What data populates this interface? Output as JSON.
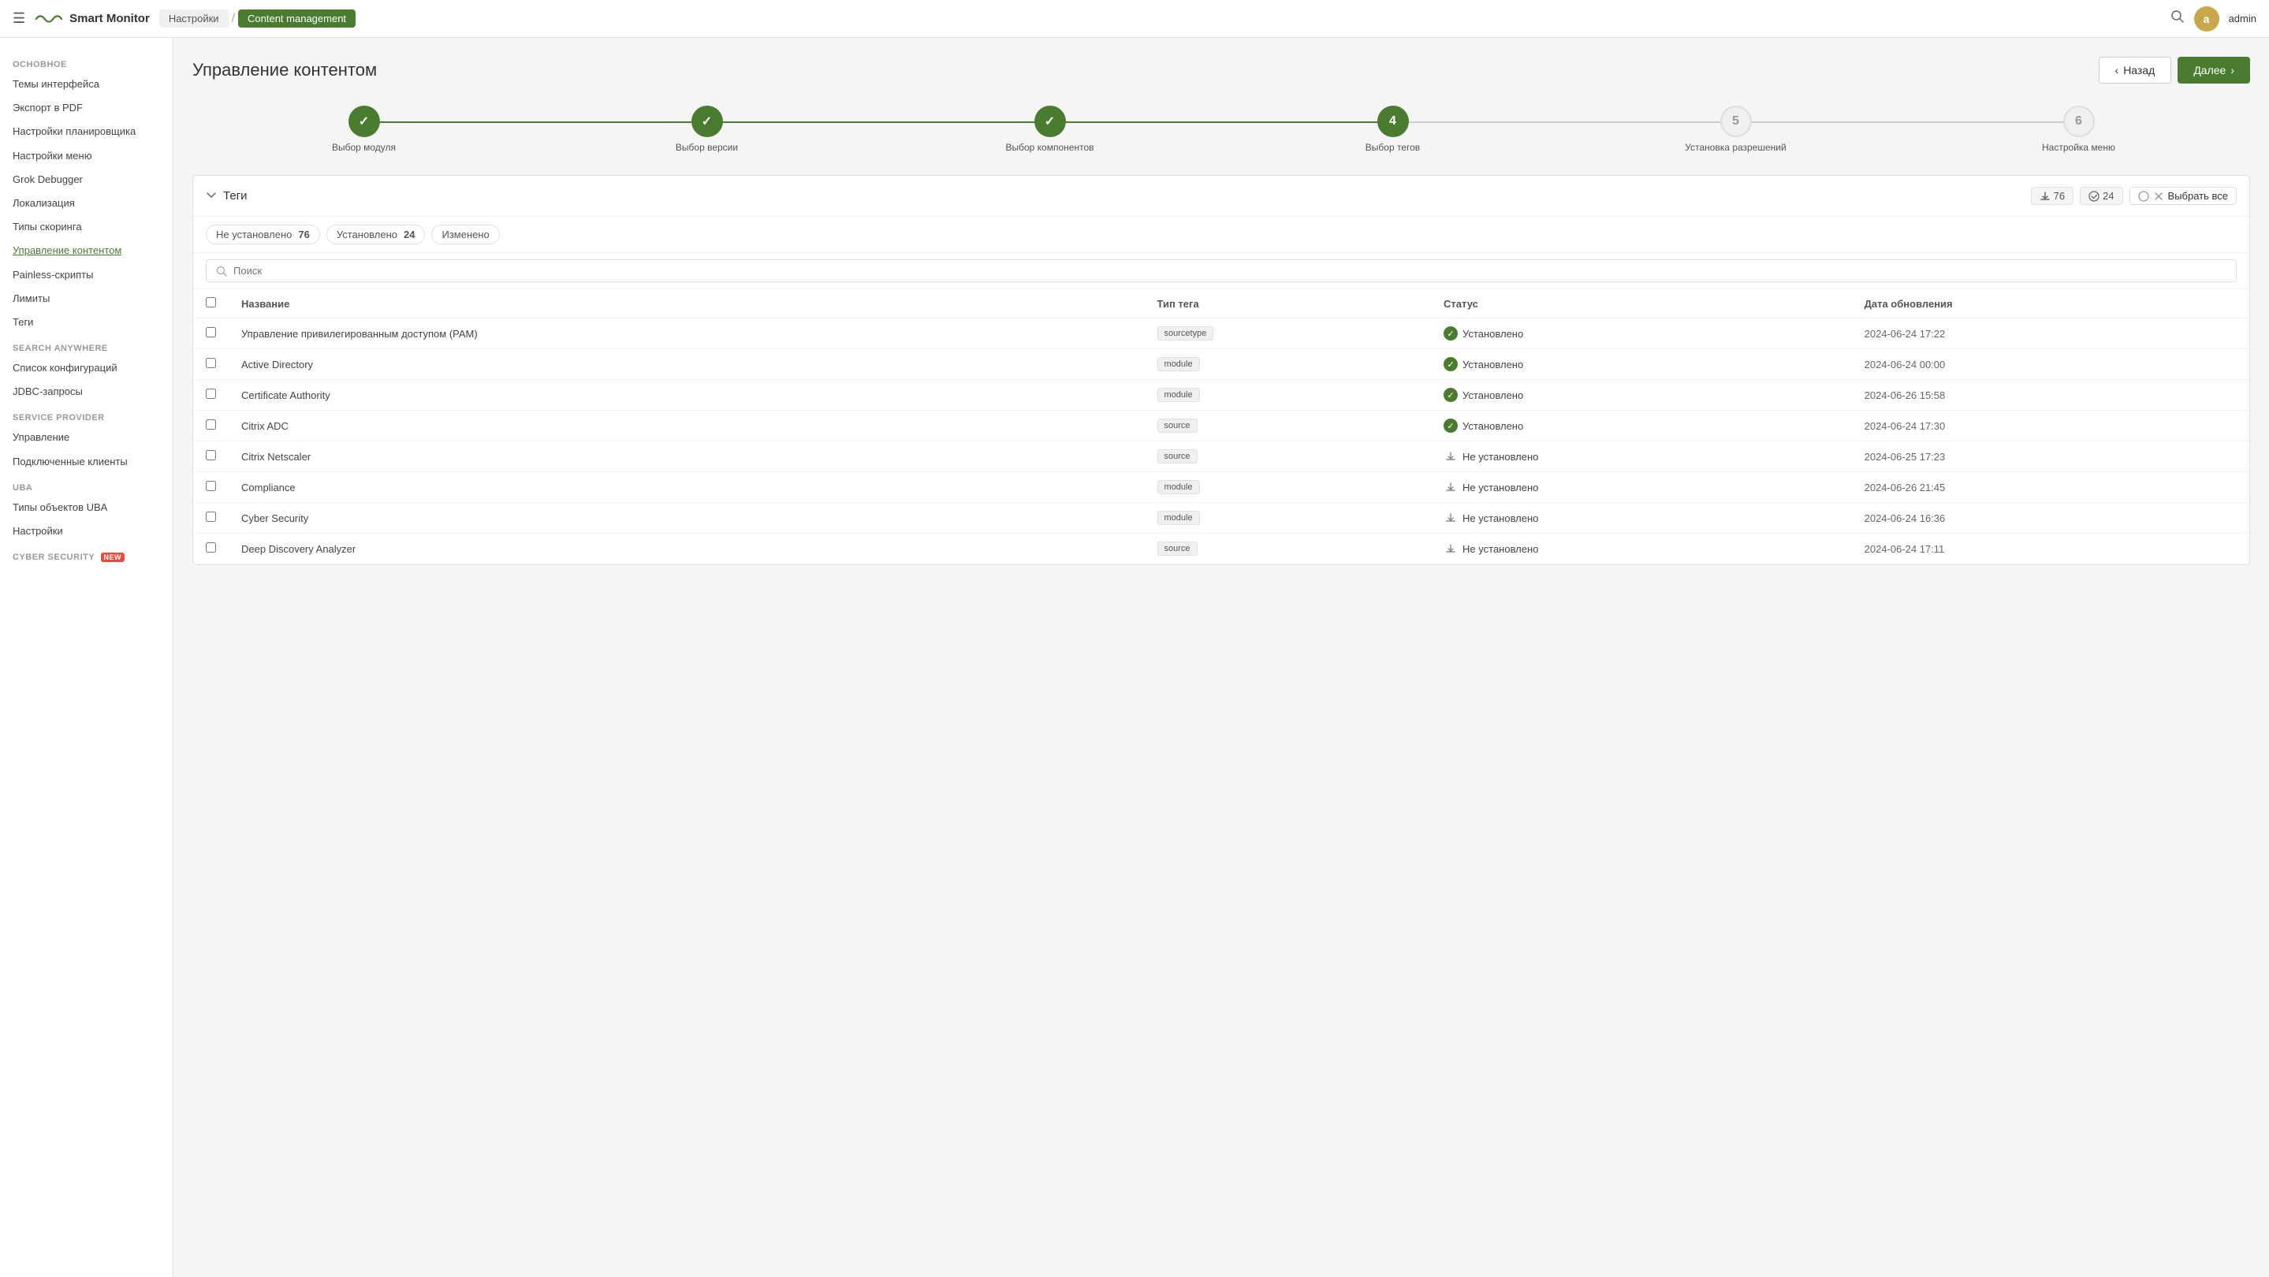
{
  "header": {
    "menu_icon": "☰",
    "logo_text": "Smart Monitor",
    "breadcrumbs": [
      {
        "label": "Настройки",
        "active": false
      },
      {
        "label": "Content management",
        "active": true
      }
    ],
    "search_icon": "🔍",
    "avatar_letter": "a",
    "username": "admin"
  },
  "sidebar": {
    "sections": [
      {
        "title": "ОСНОВНОЕ",
        "items": [
          {
            "label": "Темы интерфейса",
            "active": false
          },
          {
            "label": "Экспорт в PDF",
            "active": false
          },
          {
            "label": "Настройки планировщика",
            "active": false
          },
          {
            "label": "Настройки меню",
            "active": false
          },
          {
            "label": "Grok Debugger",
            "active": false
          },
          {
            "label": "Локализация",
            "active": false
          },
          {
            "label": "Типы скоринга",
            "active": false
          },
          {
            "label": "Управление контентом",
            "active": true
          },
          {
            "label": "Painless-скрипты",
            "active": false
          },
          {
            "label": "Лимиты",
            "active": false
          },
          {
            "label": "Теги",
            "active": false
          }
        ]
      },
      {
        "title": "SEARCH ANYWHERE",
        "items": [
          {
            "label": "Список конфигураций",
            "active": false
          },
          {
            "label": "JDBC-запросы",
            "active": false
          }
        ]
      },
      {
        "title": "SERVICE PROVIDER",
        "items": [
          {
            "label": "Управление",
            "active": false
          },
          {
            "label": "Подключенные клиенты",
            "active": false
          }
        ]
      },
      {
        "title": "UBA",
        "items": [
          {
            "label": "Типы объектов UBA",
            "active": false
          },
          {
            "label": "Настройки",
            "active": false
          }
        ]
      },
      {
        "title": "CYBER SECURITY",
        "new_badge": "NEW",
        "items": []
      }
    ]
  },
  "main": {
    "page_title": "Управление контентом",
    "btn_back": "Назад",
    "btn_next": "Далее",
    "steps": [
      {
        "label": "Выбор модуля",
        "state": "done",
        "display": "✓"
      },
      {
        "label": "Выбор версии",
        "state": "done",
        "display": "✓"
      },
      {
        "label": "Выбор компонентов",
        "state": "done",
        "display": "✓"
      },
      {
        "label": "Выбор тегов",
        "state": "active",
        "display": "4"
      },
      {
        "label": "Установка разрешений",
        "state": "pending",
        "display": "5"
      },
      {
        "label": "Настройка меню",
        "state": "pending",
        "display": "6"
      }
    ],
    "panel": {
      "title": "Теги",
      "badge_download_count": "76",
      "badge_check_count": "24",
      "select_all_label": "Выбрать все",
      "filters": [
        {
          "label": "Не установлено",
          "count": "76"
        },
        {
          "label": "Установлено",
          "count": "24"
        },
        {
          "label": "Изменено"
        }
      ],
      "search_placeholder": "Поиск",
      "table": {
        "columns": [
          {
            "key": "checkbox",
            "label": ""
          },
          {
            "key": "name",
            "label": "Название"
          },
          {
            "key": "tag_type",
            "label": "Тип тега"
          },
          {
            "key": "status",
            "label": "Статус"
          },
          {
            "key": "updated",
            "label": "Дата обновления"
          }
        ],
        "rows": [
          {
            "name": "Управление привилегированным доступом (PAM)",
            "tag_type": "sourcetype",
            "status": "installed",
            "status_label": "Установлено",
            "updated": "2024-06-24 17:22"
          },
          {
            "name": "Active Directory",
            "tag_type": "module",
            "status": "installed",
            "status_label": "Установлено",
            "updated": "2024-06-24 00:00"
          },
          {
            "name": "Certificate Authority",
            "tag_type": "module",
            "status": "installed",
            "status_label": "Установлено",
            "updated": "2024-06-26 15:58"
          },
          {
            "name": "Citrix ADC",
            "tag_type": "source",
            "status": "installed",
            "status_label": "Установлено",
            "updated": "2024-06-24 17:30"
          },
          {
            "name": "Citrix Netscaler",
            "tag_type": "source",
            "status": "not_installed",
            "status_label": "Не установлено",
            "updated": "2024-06-25 17:23"
          },
          {
            "name": "Compliance",
            "tag_type": "module",
            "status": "not_installed",
            "status_label": "Не установлено",
            "updated": "2024-06-26 21:45"
          },
          {
            "name": "Cyber Security",
            "tag_type": "module",
            "status": "not_installed",
            "status_label": "Не установлено",
            "updated": "2024-06-24 16:36"
          },
          {
            "name": "Deep Discovery Analyzer",
            "tag_type": "source",
            "status": "not_installed",
            "status_label": "Не установлено",
            "updated": "2024-06-24 17:11"
          }
        ]
      }
    }
  }
}
